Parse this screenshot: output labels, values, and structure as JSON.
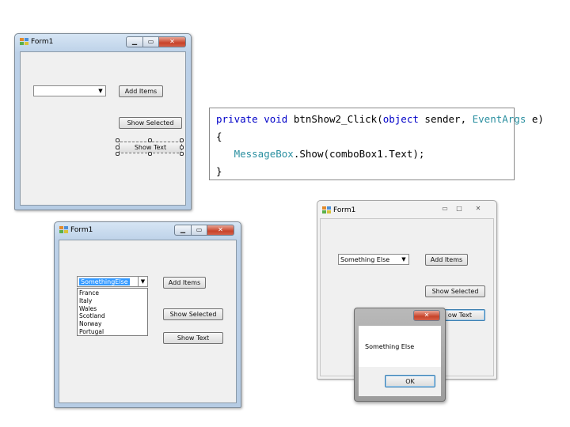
{
  "designer_form": {
    "title": "Form1",
    "add_items_label": "Add Items",
    "show_selected_label": "Show Selected",
    "show_text_label": "Show Text"
  },
  "code": {
    "line1": {
      "kw1": "private void",
      "name": " btnShow2_Click(",
      "kw2": "object",
      "mid": " sender, ",
      "ty": "EventArgs",
      "end": " e)"
    },
    "line2": "{",
    "line3": {
      "ty": "MessageBox",
      "rest": ".Show(comboBox1.Text);"
    },
    "line4": "}"
  },
  "dropdown_form": {
    "title": "Form1",
    "combo_value": "SomethingElse",
    "options": [
      "France",
      "Italy",
      "Wales",
      "Scotland",
      "Norway",
      "Portugal"
    ],
    "add_items_label": "Add Items",
    "show_selected_label": "Show Selected",
    "show_text_label": "Show Text"
  },
  "result_form": {
    "title": "Form1",
    "combo_value": "Something Else",
    "add_items_label": "Add Items",
    "show_selected_label": "Show Selected",
    "show_text_label_partial": "ow Text",
    "min_icon": "▭",
    "max_icon": "□",
    "close_icon": "✕"
  },
  "message_box": {
    "message": "Something Else",
    "ok_label": "OK",
    "close_icon": "✕"
  },
  "colors": {
    "keyword": "#0000c8",
    "type": "#2a8fa0",
    "close_button": "#c8432a",
    "selection": "#3399ff"
  },
  "icons": {
    "minimize": "minimize-icon",
    "maximize": "maximize-icon",
    "close": "close-icon",
    "dropdown": "chevron-down-icon",
    "app": "form-icon"
  }
}
